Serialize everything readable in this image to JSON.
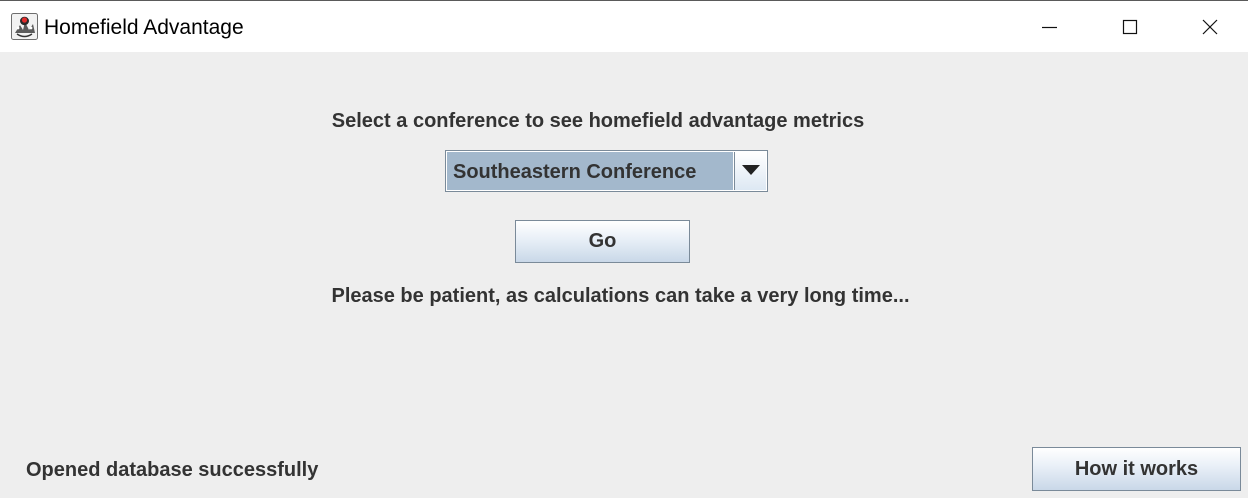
{
  "window": {
    "title": "Homefield Advantage",
    "app_icon": "java-duke-icon",
    "controls": {
      "minimize_icon": "minimize-icon",
      "maximize_icon": "maximize-icon",
      "close_icon": "close-icon"
    }
  },
  "main": {
    "prompt": "Select a conference to see homefield advantage metrics",
    "conference_select": {
      "selected": "Southeastern Conference",
      "arrow_icon": "triangle-down-icon"
    },
    "go_label": "Go",
    "patience_text": "Please be patient, as calculations can take a very long time..."
  },
  "footer": {
    "status": "Opened database successfully",
    "how_it_works_label": "How it works"
  },
  "colors": {
    "background": "#eeeeee",
    "titlebar": "#ffffff",
    "combo_selection": "#a3b8cc",
    "text": "#333333",
    "border": "#7a8a99"
  }
}
